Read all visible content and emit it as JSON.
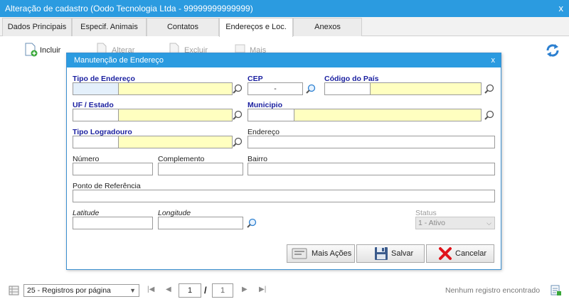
{
  "window": {
    "title": "Alteração de cadastro (Oodo Tecnologia Ltda - 99999999999999)",
    "close": "x"
  },
  "tabs": [
    "Dados Principais",
    "Especif. Animais",
    "Contatos",
    "Endereços e Loc.",
    "Anexos"
  ],
  "toolbar": {
    "incluir": "Incluir",
    "alterar": "Alterar",
    "excluir": "Excluir",
    "mais_acoes": "Mais Ações"
  },
  "dialog": {
    "title": "Manutenção de Endereço",
    "close": "x",
    "labels": {
      "tipo_endereco": "Tipo de Endereço",
      "cep": "CEP",
      "codigo_pais": "Código do País",
      "uf": "UF / Estado",
      "municipio": "Municipio",
      "tipo_logradouro": "Tipo Logradouro",
      "endereco": "Endereço",
      "numero": "Número",
      "complemento": "Complemento",
      "bairro": "Bairro",
      "ponto_referencia": "Ponto de Referência",
      "latitude": "Latitude",
      "longitude": "Longitude",
      "status": "Status"
    },
    "values": {
      "cep": "-",
      "status": "1 - Ativo"
    },
    "buttons": {
      "mais_acoes": "Mais Ações",
      "salvar": "Salvar",
      "cancelar": "Cancelar"
    }
  },
  "footer": {
    "page_size": "25 - Registros por página",
    "current_page": "1",
    "separator": "/",
    "total_pages": "1",
    "status": "Nenhum registro encontrado"
  },
  "colors": {
    "title_bar": "#2b9be0",
    "required_label": "#1a1fa0",
    "required_field": "#ffffc0",
    "cancel_x": "#e0141b"
  }
}
